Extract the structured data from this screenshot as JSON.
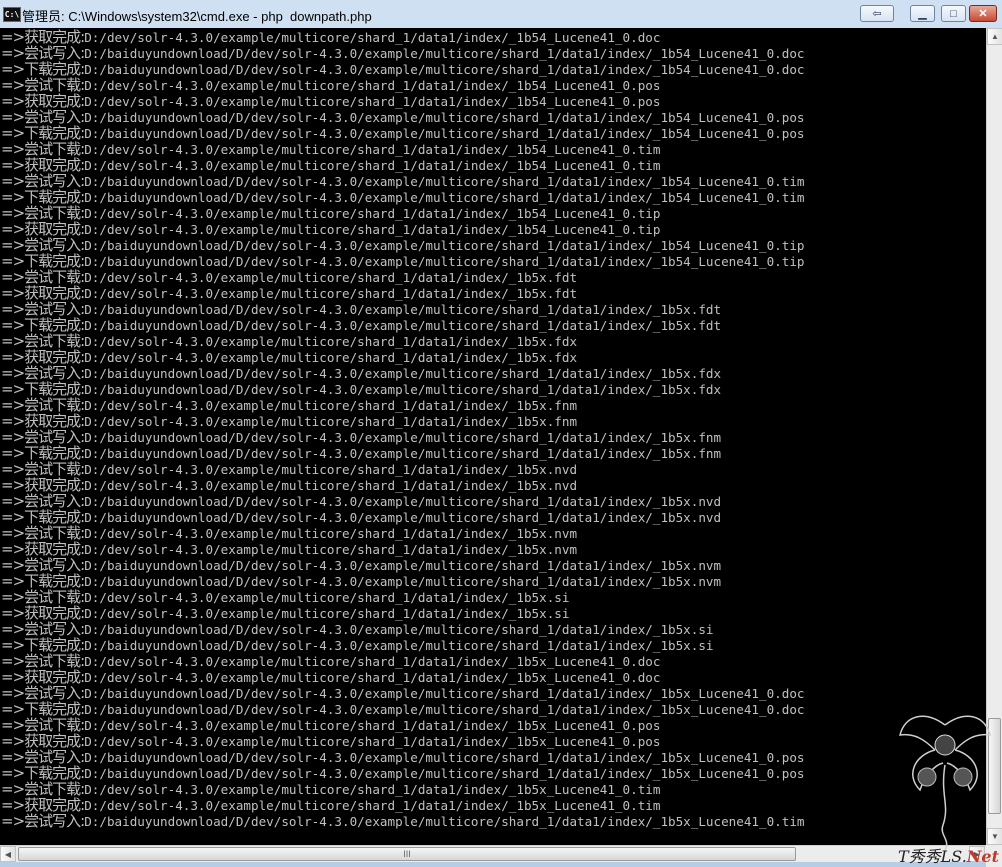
{
  "window": {
    "icon_label": "C:\\",
    "title": "管理员: C:\\Windows\\system32\\cmd.exe - php  downpath.php",
    "buttons": {
      "back": "⇦",
      "minimize": "▁",
      "maximize": "□",
      "close": "✕"
    }
  },
  "console": {
    "lines": [
      {
        "prefix": "=>获取完成",
        "path": "D:/dev/solr-4.3.0/example/multicore/shard_1/data1/index/_1b54_Lucene41_0.doc"
      },
      {
        "prefix": "=>尝试写入",
        "path": "D:/baiduyundownload/D/dev/solr-4.3.0/example/multicore/shard_1/data1/index/_1b54_Lucene41_0.doc"
      },
      {
        "prefix": "=>下载完成",
        "path": "D:/baiduyundownload/D/dev/solr-4.3.0/example/multicore/shard_1/data1/index/_1b54_Lucene41_0.doc"
      },
      {
        "prefix": "=>尝试下载",
        "path": "D:/dev/solr-4.3.0/example/multicore/shard_1/data1/index/_1b54_Lucene41_0.pos"
      },
      {
        "prefix": "=>获取完成",
        "path": "D:/dev/solr-4.3.0/example/multicore/shard_1/data1/index/_1b54_Lucene41_0.pos"
      },
      {
        "prefix": "=>尝试写入",
        "path": "D:/baiduyundownload/D/dev/solr-4.3.0/example/multicore/shard_1/data1/index/_1b54_Lucene41_0.pos"
      },
      {
        "prefix": "=>下载完成",
        "path": "D:/baiduyundownload/D/dev/solr-4.3.0/example/multicore/shard_1/data1/index/_1b54_Lucene41_0.pos"
      },
      {
        "prefix": "=>尝试下载",
        "path": "D:/dev/solr-4.3.0/example/multicore/shard_1/data1/index/_1b54_Lucene41_0.tim"
      },
      {
        "prefix": "=>获取完成",
        "path": "D:/dev/solr-4.3.0/example/multicore/shard_1/data1/index/_1b54_Lucene41_0.tim"
      },
      {
        "prefix": "=>尝试写入",
        "path": "D:/baiduyundownload/D/dev/solr-4.3.0/example/multicore/shard_1/data1/index/_1b54_Lucene41_0.tim"
      },
      {
        "prefix": "=>下载完成",
        "path": "D:/baiduyundownload/D/dev/solr-4.3.0/example/multicore/shard_1/data1/index/_1b54_Lucene41_0.tim"
      },
      {
        "prefix": "=>尝试下载",
        "path": "D:/dev/solr-4.3.0/example/multicore/shard_1/data1/index/_1b54_Lucene41_0.tip"
      },
      {
        "prefix": "=>获取完成",
        "path": "D:/dev/solr-4.3.0/example/multicore/shard_1/data1/index/_1b54_Lucene41_0.tip"
      },
      {
        "prefix": "=>尝试写入",
        "path": "D:/baiduyundownload/D/dev/solr-4.3.0/example/multicore/shard_1/data1/index/_1b54_Lucene41_0.tip"
      },
      {
        "prefix": "=>下载完成",
        "path": "D:/baiduyundownload/D/dev/solr-4.3.0/example/multicore/shard_1/data1/index/_1b54_Lucene41_0.tip"
      },
      {
        "prefix": "=>尝试下载",
        "path": "D:/dev/solr-4.3.0/example/multicore/shard_1/data1/index/_1b5x.fdt"
      },
      {
        "prefix": "=>获取完成",
        "path": "D:/dev/solr-4.3.0/example/multicore/shard_1/data1/index/_1b5x.fdt"
      },
      {
        "prefix": "=>尝试写入",
        "path": "D:/baiduyundownload/D/dev/solr-4.3.0/example/multicore/shard_1/data1/index/_1b5x.fdt"
      },
      {
        "prefix": "=>下载完成",
        "path": "D:/baiduyundownload/D/dev/solr-4.3.0/example/multicore/shard_1/data1/index/_1b5x.fdt"
      },
      {
        "prefix": "=>尝试下载",
        "path": "D:/dev/solr-4.3.0/example/multicore/shard_1/data1/index/_1b5x.fdx"
      },
      {
        "prefix": "=>获取完成",
        "path": "D:/dev/solr-4.3.0/example/multicore/shard_1/data1/index/_1b5x.fdx"
      },
      {
        "prefix": "=>尝试写入",
        "path": "D:/baiduyundownload/D/dev/solr-4.3.0/example/multicore/shard_1/data1/index/_1b5x.fdx"
      },
      {
        "prefix": "=>下载完成",
        "path": "D:/baiduyundownload/D/dev/solr-4.3.0/example/multicore/shard_1/data1/index/_1b5x.fdx"
      },
      {
        "prefix": "=>尝试下载",
        "path": "D:/dev/solr-4.3.0/example/multicore/shard_1/data1/index/_1b5x.fnm"
      },
      {
        "prefix": "=>获取完成",
        "path": "D:/dev/solr-4.3.0/example/multicore/shard_1/data1/index/_1b5x.fnm"
      },
      {
        "prefix": "=>尝试写入",
        "path": "D:/baiduyundownload/D/dev/solr-4.3.0/example/multicore/shard_1/data1/index/_1b5x.fnm"
      },
      {
        "prefix": "=>下载完成",
        "path": "D:/baiduyundownload/D/dev/solr-4.3.0/example/multicore/shard_1/data1/index/_1b5x.fnm"
      },
      {
        "prefix": "=>尝试下载",
        "path": "D:/dev/solr-4.3.0/example/multicore/shard_1/data1/index/_1b5x.nvd"
      },
      {
        "prefix": "=>获取完成",
        "path": "D:/dev/solr-4.3.0/example/multicore/shard_1/data1/index/_1b5x.nvd"
      },
      {
        "prefix": "=>尝试写入",
        "path": "D:/baiduyundownload/D/dev/solr-4.3.0/example/multicore/shard_1/data1/index/_1b5x.nvd"
      },
      {
        "prefix": "=>下载完成",
        "path": "D:/baiduyundownload/D/dev/solr-4.3.0/example/multicore/shard_1/data1/index/_1b5x.nvd"
      },
      {
        "prefix": "=>尝试下载",
        "path": "D:/dev/solr-4.3.0/example/multicore/shard_1/data1/index/_1b5x.nvm"
      },
      {
        "prefix": "=>获取完成",
        "path": "D:/dev/solr-4.3.0/example/multicore/shard_1/data1/index/_1b5x.nvm"
      },
      {
        "prefix": "=>尝试写入",
        "path": "D:/baiduyundownload/D/dev/solr-4.3.0/example/multicore/shard_1/data1/index/_1b5x.nvm"
      },
      {
        "prefix": "=>下载完成",
        "path": "D:/baiduyundownload/D/dev/solr-4.3.0/example/multicore/shard_1/data1/index/_1b5x.nvm"
      },
      {
        "prefix": "=>尝试下载",
        "path": "D:/dev/solr-4.3.0/example/multicore/shard_1/data1/index/_1b5x.si"
      },
      {
        "prefix": "=>获取完成",
        "path": "D:/dev/solr-4.3.0/example/multicore/shard_1/data1/index/_1b5x.si"
      },
      {
        "prefix": "=>尝试写入",
        "path": "D:/baiduyundownload/D/dev/solr-4.3.0/example/multicore/shard_1/data1/index/_1b5x.si"
      },
      {
        "prefix": "=>下载完成",
        "path": "D:/baiduyundownload/D/dev/solr-4.3.0/example/multicore/shard_1/data1/index/_1b5x.si"
      },
      {
        "prefix": "=>尝试下载",
        "path": "D:/dev/solr-4.3.0/example/multicore/shard_1/data1/index/_1b5x_Lucene41_0.doc"
      },
      {
        "prefix": "=>获取完成",
        "path": "D:/dev/solr-4.3.0/example/multicore/shard_1/data1/index/_1b5x_Lucene41_0.doc"
      },
      {
        "prefix": "=>尝试写入",
        "path": "D:/baiduyundownload/D/dev/solr-4.3.0/example/multicore/shard_1/data1/index/_1b5x_Lucene41_0.doc"
      },
      {
        "prefix": "=>下载完成",
        "path": "D:/baiduyundownload/D/dev/solr-4.3.0/example/multicore/shard_1/data1/index/_1b5x_Lucene41_0.doc"
      },
      {
        "prefix": "=>尝试下载",
        "path": "D:/dev/solr-4.3.0/example/multicore/shard_1/data1/index/_1b5x_Lucene41_0.pos"
      },
      {
        "prefix": "=>获取完成",
        "path": "D:/dev/solr-4.3.0/example/multicore/shard_1/data1/index/_1b5x_Lucene41_0.pos"
      },
      {
        "prefix": "=>尝试写入",
        "path": "D:/baiduyundownload/D/dev/solr-4.3.0/example/multicore/shard_1/data1/index/_1b5x_Lucene41_0.pos"
      },
      {
        "prefix": "=>下载完成",
        "path": "D:/baiduyundownload/D/dev/solr-4.3.0/example/multicore/shard_1/data1/index/_1b5x_Lucene41_0.pos"
      },
      {
        "prefix": "=>尝试下载",
        "path": "D:/dev/solr-4.3.0/example/multicore/shard_1/data1/index/_1b5x_Lucene41_0.tim"
      },
      {
        "prefix": "=>获取完成",
        "path": "D:/dev/solr-4.3.0/example/multicore/shard_1/data1/index/_1b5x_Lucene41_0.tim"
      },
      {
        "prefix": "=>尝试写入",
        "path": "D:/baiduyundownload/D/dev/solr-4.3.0/example/multicore/shard_1/data1/index/_1b5x_Lucene41_0.tim"
      }
    ]
  },
  "scrollbars": {
    "vertical": {
      "position_fraction": 0.98
    },
    "horizontal": {
      "grip": "III"
    }
  },
  "watermark": {
    "text": "T秀秀LS.",
    "net": "Net"
  },
  "colors": {
    "console_bg": "#000000",
    "console_text": "#c0c0c0",
    "titlebar": "#c9d9ea"
  }
}
